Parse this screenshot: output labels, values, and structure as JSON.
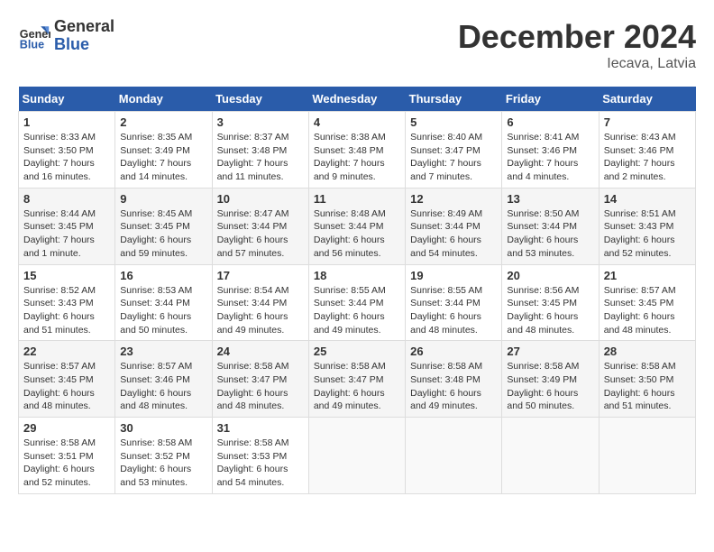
{
  "header": {
    "logo_line1": "General",
    "logo_line2": "Blue",
    "title": "December 2024",
    "subtitle": "Iecava, Latvia"
  },
  "days_of_week": [
    "Sunday",
    "Monday",
    "Tuesday",
    "Wednesday",
    "Thursday",
    "Friday",
    "Saturday"
  ],
  "weeks": [
    [
      {
        "day": "1",
        "sunrise": "8:33 AM",
        "sunset": "3:50 PM",
        "daylight": "7 hours and 16 minutes."
      },
      {
        "day": "2",
        "sunrise": "8:35 AM",
        "sunset": "3:49 PM",
        "daylight": "7 hours and 14 minutes."
      },
      {
        "day": "3",
        "sunrise": "8:37 AM",
        "sunset": "3:48 PM",
        "daylight": "7 hours and 11 minutes."
      },
      {
        "day": "4",
        "sunrise": "8:38 AM",
        "sunset": "3:48 PM",
        "daylight": "7 hours and 9 minutes."
      },
      {
        "day": "5",
        "sunrise": "8:40 AM",
        "sunset": "3:47 PM",
        "daylight": "7 hours and 7 minutes."
      },
      {
        "day": "6",
        "sunrise": "8:41 AM",
        "sunset": "3:46 PM",
        "daylight": "7 hours and 4 minutes."
      },
      {
        "day": "7",
        "sunrise": "8:43 AM",
        "sunset": "3:46 PM",
        "daylight": "7 hours and 2 minutes."
      }
    ],
    [
      {
        "day": "8",
        "sunrise": "8:44 AM",
        "sunset": "3:45 PM",
        "daylight": "7 hours and 1 minute."
      },
      {
        "day": "9",
        "sunrise": "8:45 AM",
        "sunset": "3:45 PM",
        "daylight": "6 hours and 59 minutes."
      },
      {
        "day": "10",
        "sunrise": "8:47 AM",
        "sunset": "3:44 PM",
        "daylight": "6 hours and 57 minutes."
      },
      {
        "day": "11",
        "sunrise": "8:48 AM",
        "sunset": "3:44 PM",
        "daylight": "6 hours and 56 minutes."
      },
      {
        "day": "12",
        "sunrise": "8:49 AM",
        "sunset": "3:44 PM",
        "daylight": "6 hours and 54 minutes."
      },
      {
        "day": "13",
        "sunrise": "8:50 AM",
        "sunset": "3:44 PM",
        "daylight": "6 hours and 53 minutes."
      },
      {
        "day": "14",
        "sunrise": "8:51 AM",
        "sunset": "3:43 PM",
        "daylight": "6 hours and 52 minutes."
      }
    ],
    [
      {
        "day": "15",
        "sunrise": "8:52 AM",
        "sunset": "3:43 PM",
        "daylight": "6 hours and 51 minutes."
      },
      {
        "day": "16",
        "sunrise": "8:53 AM",
        "sunset": "3:44 PM",
        "daylight": "6 hours and 50 minutes."
      },
      {
        "day": "17",
        "sunrise": "8:54 AM",
        "sunset": "3:44 PM",
        "daylight": "6 hours and 49 minutes."
      },
      {
        "day": "18",
        "sunrise": "8:55 AM",
        "sunset": "3:44 PM",
        "daylight": "6 hours and 49 minutes."
      },
      {
        "day": "19",
        "sunrise": "8:55 AM",
        "sunset": "3:44 PM",
        "daylight": "6 hours and 48 minutes."
      },
      {
        "day": "20",
        "sunrise": "8:56 AM",
        "sunset": "3:45 PM",
        "daylight": "6 hours and 48 minutes."
      },
      {
        "day": "21",
        "sunrise": "8:57 AM",
        "sunset": "3:45 PM",
        "daylight": "6 hours and 48 minutes."
      }
    ],
    [
      {
        "day": "22",
        "sunrise": "8:57 AM",
        "sunset": "3:45 PM",
        "daylight": "6 hours and 48 minutes."
      },
      {
        "day": "23",
        "sunrise": "8:57 AM",
        "sunset": "3:46 PM",
        "daylight": "6 hours and 48 minutes."
      },
      {
        "day": "24",
        "sunrise": "8:58 AM",
        "sunset": "3:47 PM",
        "daylight": "6 hours and 48 minutes."
      },
      {
        "day": "25",
        "sunrise": "8:58 AM",
        "sunset": "3:47 PM",
        "daylight": "6 hours and 49 minutes."
      },
      {
        "day": "26",
        "sunrise": "8:58 AM",
        "sunset": "3:48 PM",
        "daylight": "6 hours and 49 minutes."
      },
      {
        "day": "27",
        "sunrise": "8:58 AM",
        "sunset": "3:49 PM",
        "daylight": "6 hours and 50 minutes."
      },
      {
        "day": "28",
        "sunrise": "8:58 AM",
        "sunset": "3:50 PM",
        "daylight": "6 hours and 51 minutes."
      }
    ],
    [
      {
        "day": "29",
        "sunrise": "8:58 AM",
        "sunset": "3:51 PM",
        "daylight": "6 hours and 52 minutes."
      },
      {
        "day": "30",
        "sunrise": "8:58 AM",
        "sunset": "3:52 PM",
        "daylight": "6 hours and 53 minutes."
      },
      {
        "day": "31",
        "sunrise": "8:58 AM",
        "sunset": "3:53 PM",
        "daylight": "6 hours and 54 minutes."
      },
      null,
      null,
      null,
      null
    ]
  ],
  "labels": {
    "sunrise": "Sunrise:",
    "sunset": "Sunset:",
    "daylight": "Daylight:"
  }
}
